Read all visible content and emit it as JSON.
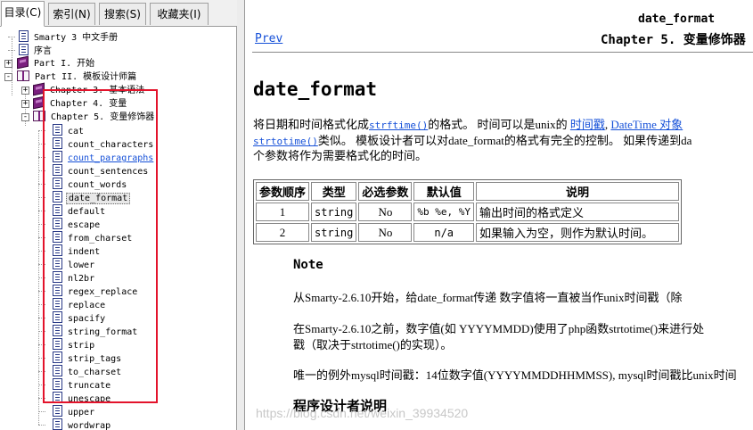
{
  "tabs": [
    {
      "label": "目录(C)",
      "active": true
    },
    {
      "label": "索引(N)",
      "active": false
    },
    {
      "label": "搜索(S)",
      "active": false
    },
    {
      "label": "收藏夹(I)",
      "active": false
    }
  ],
  "tree": {
    "root_items": [
      "Smarty 3 中文手册",
      "序言"
    ],
    "part1": "Part I. 开始",
    "part2": "Part II. 模板设计师篇",
    "ch3": "Chapter 3. 基本语法",
    "ch4": "Chapter 4. 变量",
    "ch5": "Chapter 5. 变量修饰器",
    "modifiers": [
      "cat",
      "count_characters",
      "count_paragraphs",
      "count_sentences",
      "count_words",
      "date_format",
      "default",
      "escape",
      "from_charset",
      "indent",
      "lower",
      "nl2br",
      "regex_replace",
      "replace",
      "spacify",
      "string_format",
      "strip",
      "strip_tags",
      "to_charset",
      "truncate",
      "unescape",
      "upper",
      "wordwrap"
    ],
    "link_item": "count_paragraphs",
    "selected_item": "date_format"
  },
  "doc": {
    "nav_title": "date_format",
    "prev": "Prev",
    "chapter": "Chapter 5. 变量修饰器",
    "heading": "date_format",
    "p1_a": "将日期和时间格式化成",
    "p1_link1": "strftime()",
    "p1_b": "的格式。 时间可以是unix的 ",
    "p1_link2": "时间戳",
    "p1_c": ", ",
    "p1_link3": "DateTime 对象",
    "line2_link": "strtotime()",
    "line2_text": "类似。 模板设计者可以对date_format的格式有完全的控制。 如果传递到da",
    "line3": "个参数将作为需要格式化的时间。",
    "table_headers": [
      "参数顺序",
      "类型",
      "必选参数",
      "默认值",
      "说明"
    ],
    "table_rows": [
      [
        "1",
        "string",
        "No",
        "%b %e, %Y",
        "输出时间的格式定义"
      ],
      [
        "2",
        "string",
        "No",
        "n/a",
        "如果输入为空，则作为默认时间。"
      ]
    ],
    "note_title": "Note",
    "note1": "从Smarty-2.6.10开始，给date_format传递 数字值将一直被当作unix时间戳（除",
    "note2a": "在Smarty-2.6.10之前，数字值(如 YYYYMMDD)使用了php函数strtotime()来进行处",
    "note2b": "戳（取决于strtotime()的实现）。",
    "note3": "唯一的例外mysql时间戳：14位数字值(YYYYMMDDHHMMSS), mysql时间戳比unix时间",
    "section": "程序设计者说明"
  },
  "watermark": "https://blog.csdn.net/weixin_39934520"
}
